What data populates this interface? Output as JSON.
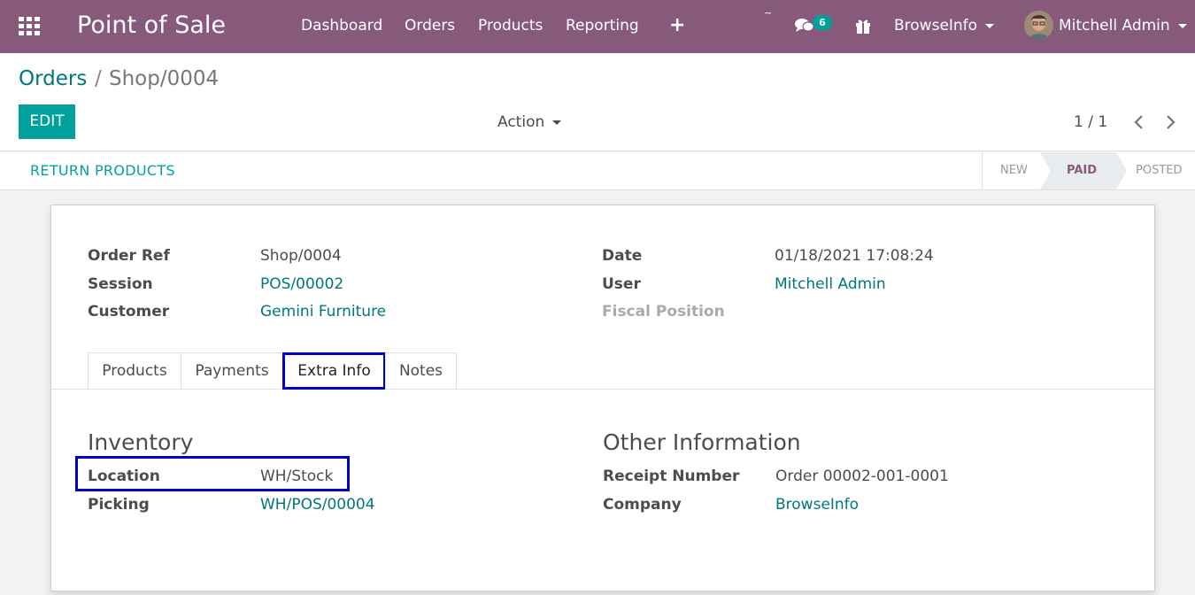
{
  "navbar": {
    "app_title": "Point of Sale",
    "menu": [
      "Dashboard",
      "Orders",
      "Products",
      "Reporting"
    ],
    "plus": "+",
    "tilde": "~",
    "message_count": "6",
    "company": "BrowseInfo",
    "user": "Mitchell Admin",
    "bg_color": "#875a7b"
  },
  "breadcrumb": {
    "parent": "Orders",
    "separator": "/",
    "current": "Shop/0004"
  },
  "toolbar": {
    "edit_label": "EDIT",
    "action_label": "Action",
    "pager": "1 / 1"
  },
  "statusbar": {
    "return_label": "RETURN PRODUCTS",
    "states": [
      "NEW",
      "PAID",
      "POSTED"
    ],
    "active_state": "PAID"
  },
  "form": {
    "left": [
      {
        "label": "Order Ref",
        "value": "Shop/0004"
      },
      {
        "label": "Session",
        "value": "POS/00002"
      },
      {
        "label": "Customer",
        "value": "Gemini Furniture"
      }
    ],
    "right": [
      {
        "label": "Date",
        "value": "01/18/2021 17:08:24"
      },
      {
        "label": "User",
        "value": "Mitchell Admin"
      },
      {
        "label": "Fiscal Position",
        "value": ""
      }
    ],
    "tabs": [
      "Products",
      "Payments",
      "Extra Info",
      "Notes"
    ],
    "active_tab": "Extra Info",
    "inventory": {
      "title": "Inventory",
      "fields": [
        {
          "label": "Location",
          "value": "WH/Stock"
        },
        {
          "label": "Picking",
          "value": "WH/POS/00004"
        }
      ]
    },
    "other": {
      "title": "Other Information",
      "fields": [
        {
          "label": "Receipt Number",
          "value": "Order 00002-001-0001"
        },
        {
          "label": "Company",
          "value": "BrowseInfo"
        }
      ]
    }
  },
  "colors": {
    "accent": "#00a09d",
    "link": "#00787a",
    "highlight": "#0000cc"
  }
}
